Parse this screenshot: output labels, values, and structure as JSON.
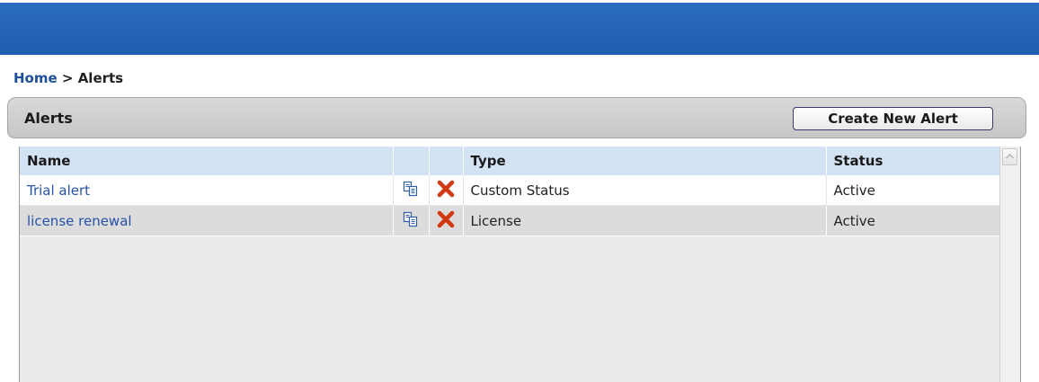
{
  "breadcrumb": {
    "home": "Home",
    "separator": " > ",
    "current": "Alerts"
  },
  "panel": {
    "title": "Alerts",
    "create_button_label": "Create New Alert"
  },
  "table": {
    "columns": [
      "Name",
      "",
      "",
      "Type",
      "Status"
    ],
    "rows": [
      {
        "name": "Trial alert",
        "type": "Custom Status",
        "status": "Active"
      },
      {
        "name": "license renewal",
        "type": "License",
        "status": "Active"
      }
    ]
  },
  "icons": {
    "copy": "copy-icon",
    "delete": "delete-icon",
    "scroll_up": "chevron-up-icon"
  },
  "colors": {
    "topbar": "#1f5eae",
    "link": "#2652a8",
    "header_row": "#d4e3f3",
    "delete_red": "#d13a10"
  }
}
